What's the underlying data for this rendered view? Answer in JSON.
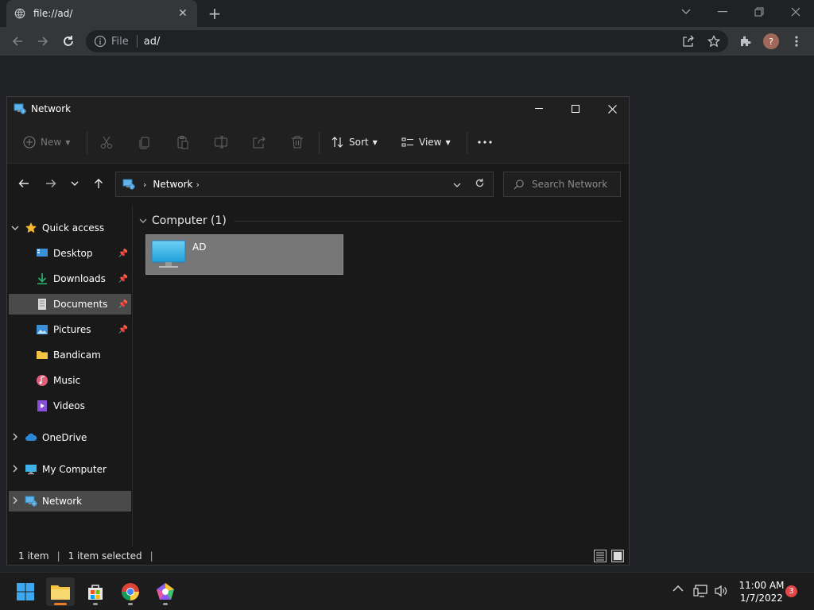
{
  "browser": {
    "tab_title": "file://ad/",
    "omnibox_scheme": "File",
    "omnibox_url": "ad/",
    "avatar_letter": "?"
  },
  "explorer": {
    "window_title": "Network",
    "commands": {
      "new": "New",
      "sort": "Sort",
      "view": "View"
    },
    "breadcrumb": "Network",
    "search_placeholder": "Search Network",
    "nav": [
      {
        "label": "Quick access"
      },
      {
        "label": "Desktop"
      },
      {
        "label": "Downloads"
      },
      {
        "label": "Documents"
      },
      {
        "label": "Pictures"
      },
      {
        "label": "Bandicam"
      },
      {
        "label": "Music"
      },
      {
        "label": "Videos"
      },
      {
        "label": "OneDrive"
      },
      {
        "label": "My Computer"
      },
      {
        "label": "Network"
      }
    ],
    "group_header": "Computer (1)",
    "items": [
      {
        "name": "AD"
      }
    ],
    "status": {
      "count": "1 item",
      "selected": "1 item selected"
    }
  },
  "taskbar": {
    "time": "11:00 AM",
    "date": "1/7/2022",
    "notification_count": "3"
  },
  "colors": {
    "accent": "#e87e2a",
    "selection": "#777777"
  }
}
